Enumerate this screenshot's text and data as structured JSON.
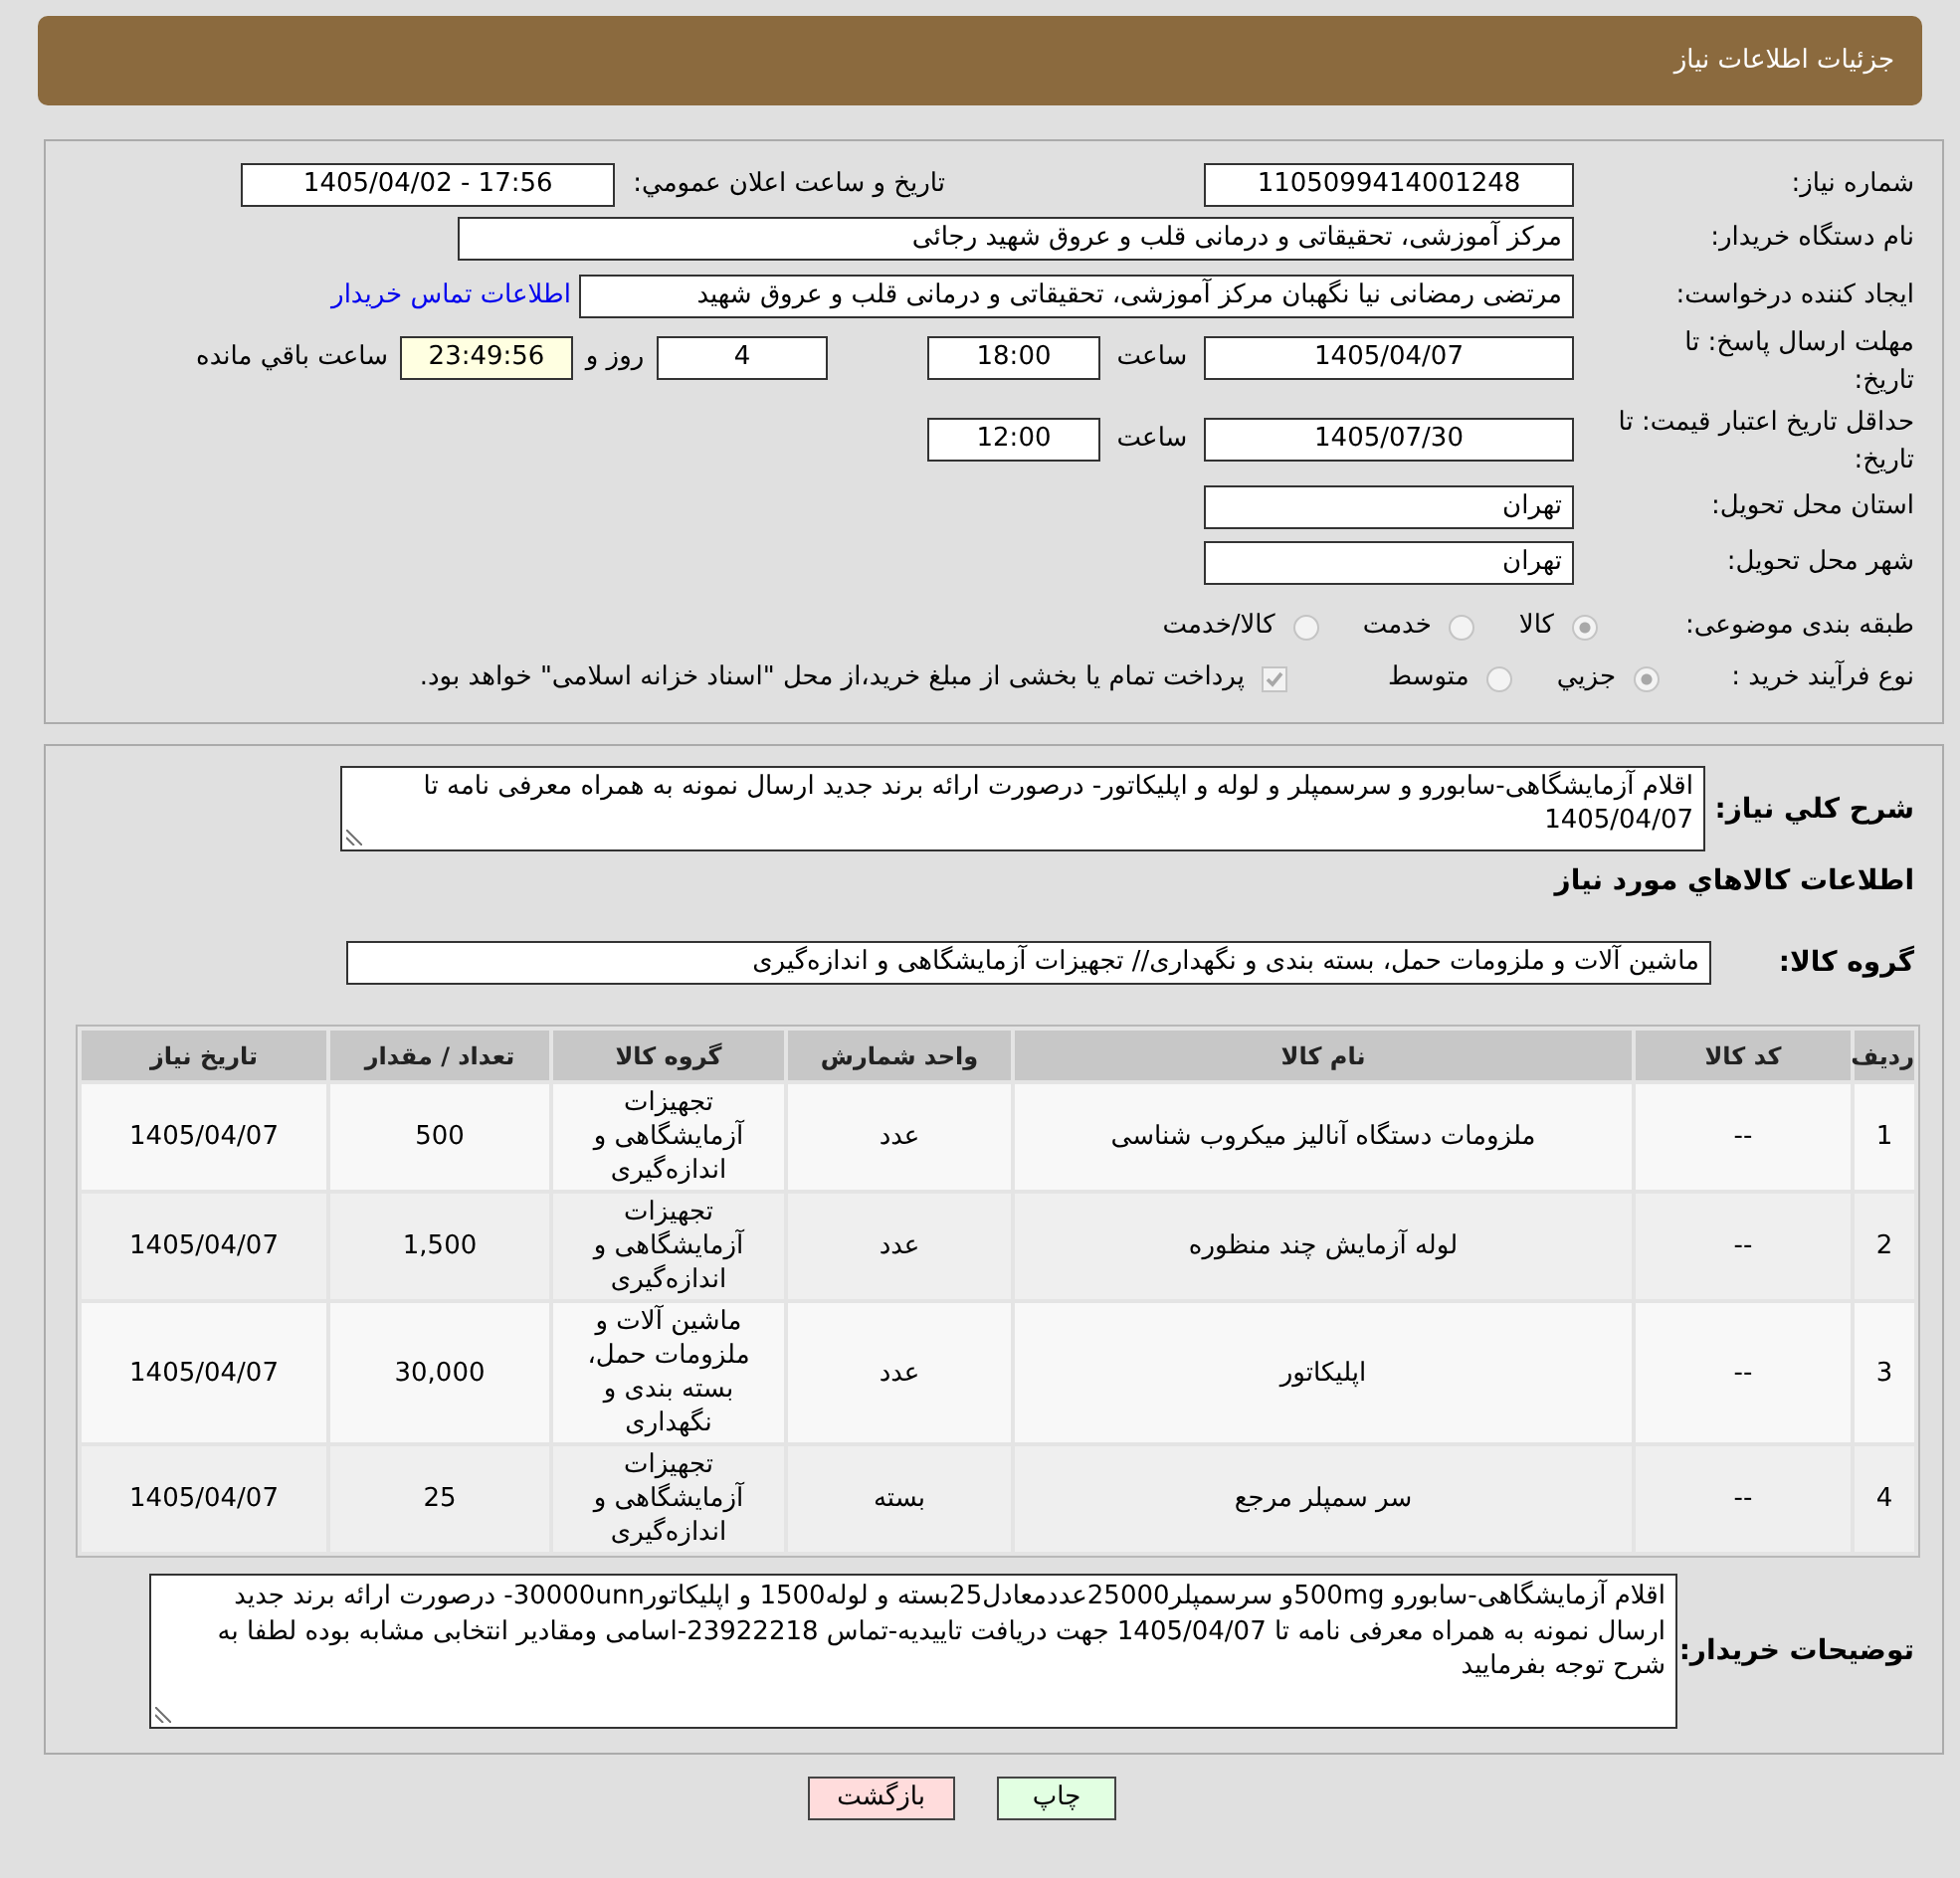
{
  "header": {
    "title": "جزئیات اطلاعات نیاز"
  },
  "details": {
    "need_number": {
      "label": "شماره نیاز:",
      "value": "1105099414001248"
    },
    "announce": {
      "label": "تاریخ و ساعت اعلان عمومي:",
      "value": "1405/04/02 - 17:56"
    },
    "buyer": {
      "label": "نام دستگاه خریدار:",
      "value": "مرکز آموزشی، تحقیقاتی و درمانی قلب و عروق شهید رجائی"
    },
    "requester": {
      "label": "ایجاد کننده درخواست:",
      "value": "مرتضی رمضانی نیا نگهبان مرکز آموزشی، تحقیقاتی و درمانی قلب و عروق شهید",
      "link": "اطلاعات تماس خریدار"
    },
    "reply_deadline": {
      "label": "مهلت ارسال پاسخ: تا تاریخ:",
      "date": "1405/04/07",
      "time_label": "ساعت",
      "time": "18:00",
      "days": "4",
      "days_label": "روز و",
      "remaining": "23:49:56",
      "remaining_label": "ساعت باقي مانده"
    },
    "price_validity": {
      "label": "حداقل تاریخ اعتبار قیمت: تا تاریخ:",
      "date": "1405/07/30",
      "time_label": "ساعت",
      "time": "12:00"
    },
    "province": {
      "label": "استان محل تحویل:",
      "value": "تهران"
    },
    "city": {
      "label": "شهر محل تحویل:",
      "value": "تهران"
    },
    "category": {
      "label": "طبقه بندی موضوعی:",
      "disabled": true,
      "options": [
        {
          "label": "کالا",
          "selected": true
        },
        {
          "label": "خدمت",
          "selected": false
        },
        {
          "label": "کالا/خدمت",
          "selected": false
        }
      ]
    },
    "process": {
      "label": "نوع فرآیند خرید :",
      "disabled": true,
      "options": [
        {
          "label": "جزيي",
          "selected": true
        },
        {
          "label": "متوسط",
          "selected": false
        }
      ],
      "treasury": {
        "label": "پرداخت تمام یا بخشی از مبلغ خرید،از محل \"اسناد خزانه اسلامی\" خواهد بود.",
        "checked": true,
        "disabled": true
      }
    }
  },
  "needs": {
    "summary": {
      "label": "شرح کلي نیاز:",
      "value": "اقلام آزمایشگاهی-سابورو و سرسمپلر و لوله و اپلیکاتور- درصورت ارائه برند جدید ارسال نمونه به همراه معرفی نامه تا 1405/04/07"
    },
    "goods_heading": "اطلاعات کالاهاي مورد نیاز",
    "group": {
      "label": "گروه کالا:",
      "value": "ماشین آلات و ملزومات حمل، بسته بندی و نگهداری// تجهیزات آزمایشگاهی و اندازه‌گیری"
    },
    "table": {
      "columns": [
        "ردیف",
        "کد کالا",
        "نام کالا",
        "واحد شمارش",
        "گروه کالا",
        "تعداد / مقدار",
        "تاریخ نیاز"
      ],
      "rows": [
        [
          "1",
          "--",
          "ملزومات دستگاه آنالیز میکروب شناسی",
          "عدد",
          "تجهیزات آزمایشگاهی و اندازه‌گیری",
          "500",
          "1405/04/07"
        ],
        [
          "2",
          "--",
          "لوله آزمایش چند منظوره",
          "عدد",
          "تجهیزات آزمایشگاهی و اندازه‌گیری",
          "1,500",
          "1405/04/07"
        ],
        [
          "3",
          "--",
          "اپلیکاتور",
          "عدد",
          "ماشین آلات و ملزومات حمل، بسته بندی و نگهداری",
          "30,000",
          "1405/04/07"
        ],
        [
          "4",
          "--",
          "سر سمپلر مرجع",
          "بسته",
          "تجهیزات آزمایشگاهی و اندازه‌گیری",
          "25",
          "1405/04/07"
        ]
      ]
    },
    "buyer_notes": {
      "label": "توضیحات خریدار:",
      "value": "اقلام آزمایشگاهی-سابورو 500mgو سرسمپلر25000عددمعادل25بسته و لوله1500 و اپلیکاتور30000unn- درصورت ارائه برند جدید ارسال نمونه به همراه معرفی نامه تا 1405/04/07 جهت دریافت تاییدیه-تماس 23922218-اسامی ومقادیر انتخابی مشابه بوده لطفا به شرح توجه بفرمایید"
    }
  },
  "buttons": [
    {
      "label": "چاپ",
      "kind": "print"
    },
    {
      "label": "بازگشت",
      "kind": "back"
    }
  ]
}
